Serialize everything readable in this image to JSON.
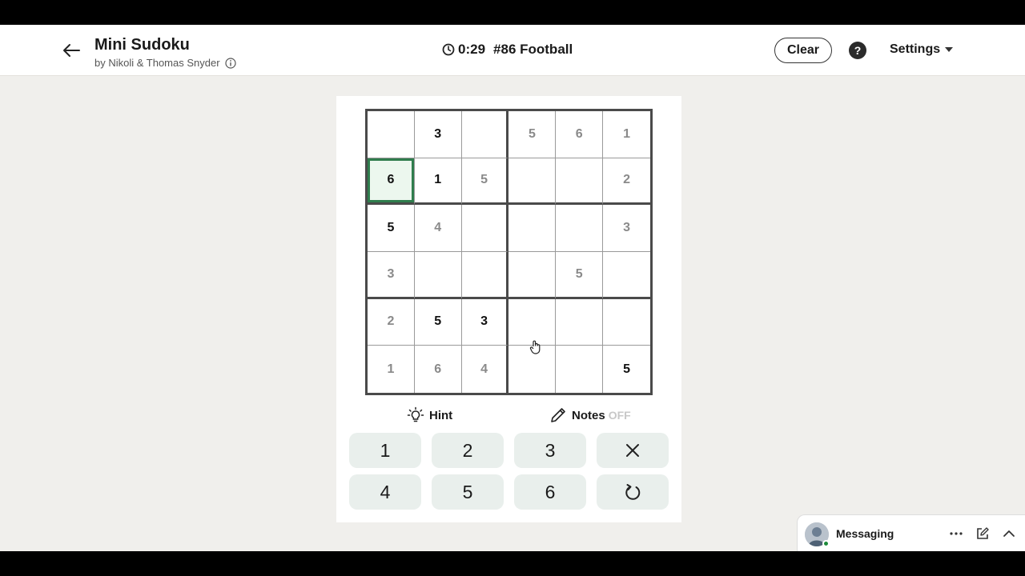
{
  "header": {
    "title": "Mini Sudoku",
    "byline": "by Nikoli & Thomas Snyder",
    "timer": "0:29",
    "puzzle": "#86 Football",
    "clear_label": "Clear",
    "help_label": "?",
    "settings_label": "Settings"
  },
  "grid": {
    "cells": [
      [
        {
          "v": "",
          "t": "empty"
        },
        {
          "v": "3",
          "t": "given"
        },
        {
          "v": "",
          "t": "empty"
        },
        {
          "v": "5",
          "t": "user"
        },
        {
          "v": "6",
          "t": "user"
        },
        {
          "v": "1",
          "t": "user"
        }
      ],
      [
        {
          "v": "6",
          "t": "given",
          "selected": true
        },
        {
          "v": "1",
          "t": "given"
        },
        {
          "v": "5",
          "t": "user"
        },
        {
          "v": "",
          "t": "empty"
        },
        {
          "v": "",
          "t": "empty"
        },
        {
          "v": "2",
          "t": "user"
        }
      ],
      [
        {
          "v": "5",
          "t": "given"
        },
        {
          "v": "4",
          "t": "user"
        },
        {
          "v": "",
          "t": "empty"
        },
        {
          "v": "",
          "t": "empty"
        },
        {
          "v": "",
          "t": "empty"
        },
        {
          "v": "3",
          "t": "user"
        }
      ],
      [
        {
          "v": "3",
          "t": "user"
        },
        {
          "v": "",
          "t": "empty"
        },
        {
          "v": "",
          "t": "empty"
        },
        {
          "v": "",
          "t": "empty"
        },
        {
          "v": "5",
          "t": "user"
        },
        {
          "v": "",
          "t": "empty"
        }
      ],
      [
        {
          "v": "2",
          "t": "user"
        },
        {
          "v": "5",
          "t": "given"
        },
        {
          "v": "3",
          "t": "given"
        },
        {
          "v": "",
          "t": "empty"
        },
        {
          "v": "",
          "t": "empty"
        },
        {
          "v": "",
          "t": "empty"
        }
      ],
      [
        {
          "v": "1",
          "t": "user"
        },
        {
          "v": "6",
          "t": "user"
        },
        {
          "v": "4",
          "t": "user"
        },
        {
          "v": "",
          "t": "empty"
        },
        {
          "v": "",
          "t": "empty"
        },
        {
          "v": "5",
          "t": "given"
        }
      ]
    ],
    "selected_color": "#2f7d4d",
    "given_color": "#111111",
    "user_color": "#8a8a8a"
  },
  "tools": {
    "hint_label": "Hint",
    "notes_label": "Notes",
    "notes_state": "OFF"
  },
  "keypad": {
    "keys": [
      "1",
      "2",
      "3",
      "4",
      "5",
      "6"
    ],
    "erase_icon": "close-icon",
    "undo_icon": "undo-icon"
  },
  "messaging": {
    "label": "Messaging",
    "status_color": "#1d8a3a"
  }
}
